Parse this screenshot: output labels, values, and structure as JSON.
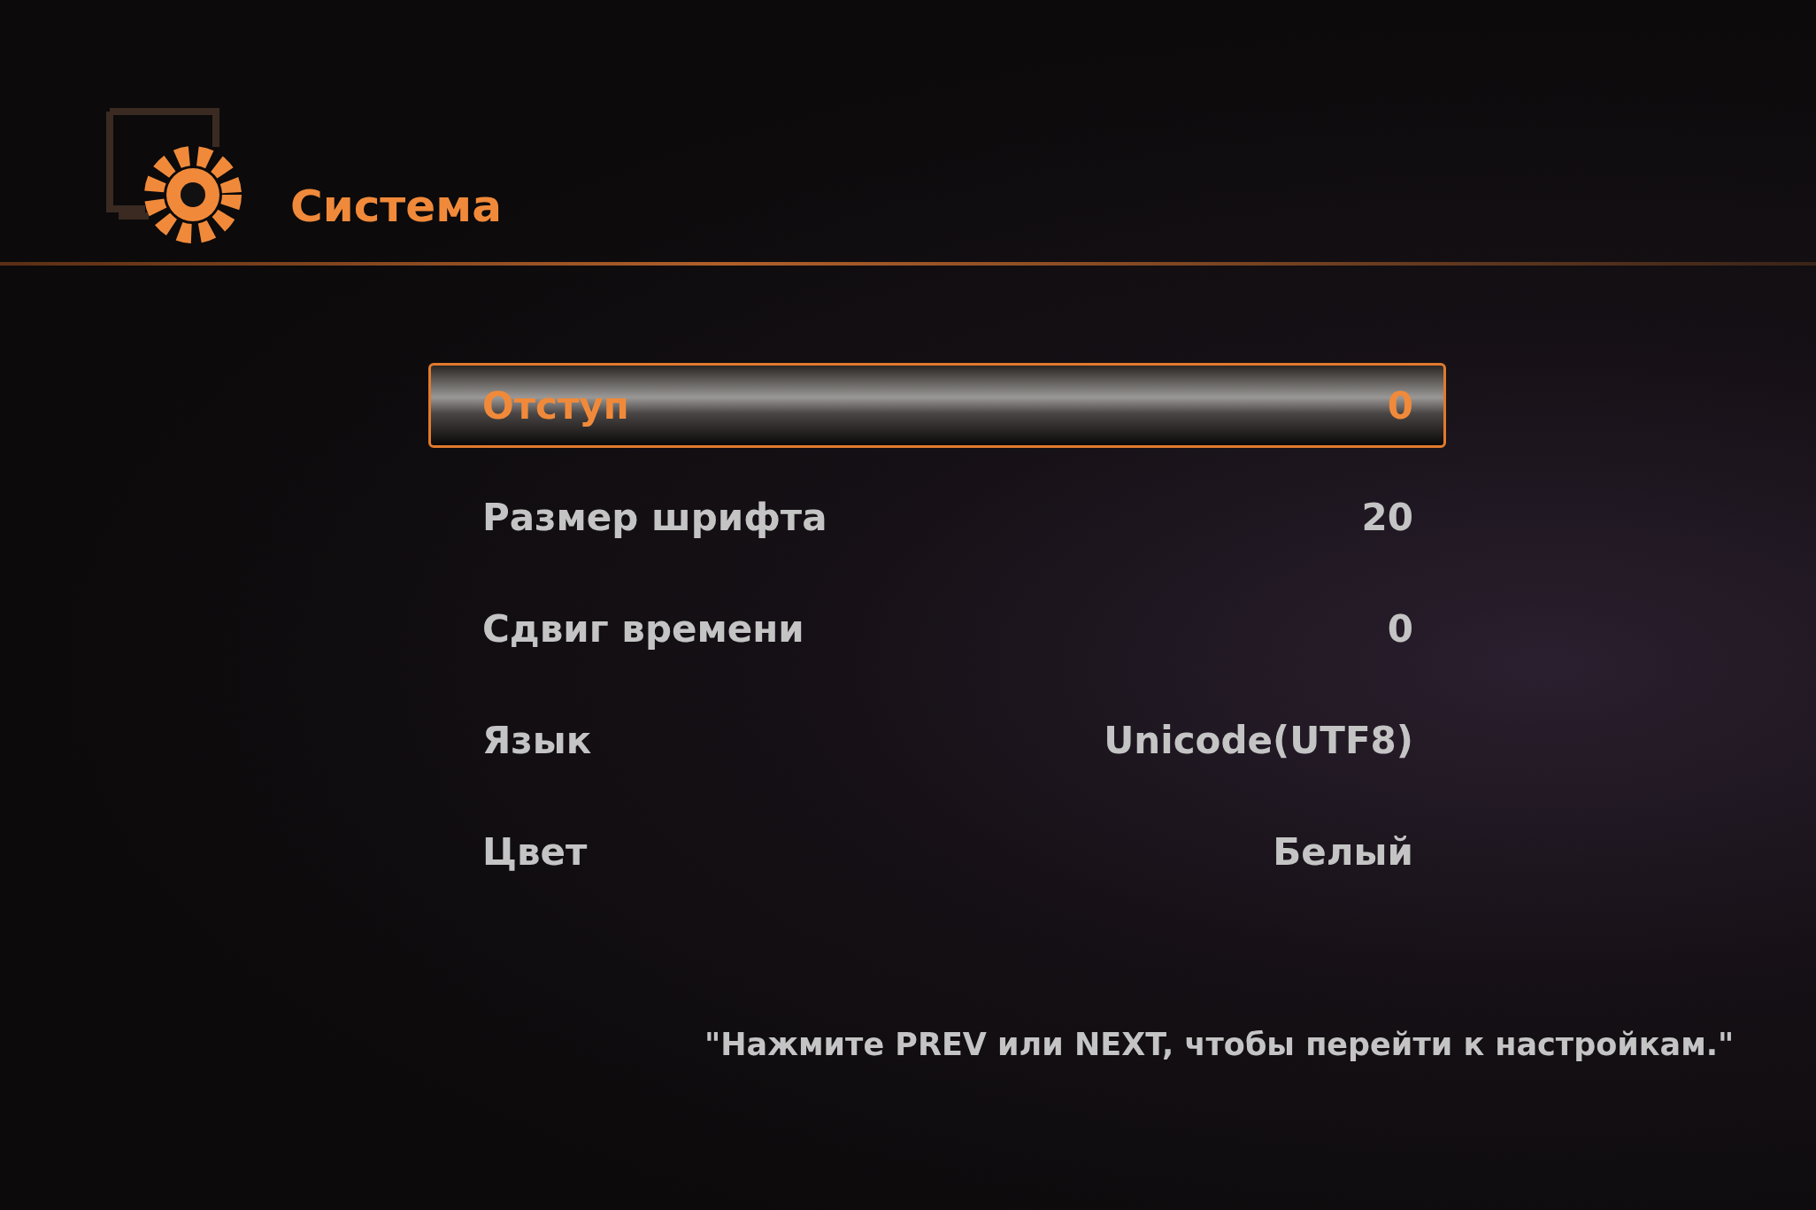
{
  "header": {
    "title": "Система"
  },
  "settings": [
    {
      "label": "Отступ",
      "value": "0",
      "selected": true
    },
    {
      "label": "Размер шрифта",
      "value": "20",
      "selected": false
    },
    {
      "label": "Сдвиг времени",
      "value": "0",
      "selected": false
    },
    {
      "label": "Язык",
      "value": "Unicode(UTF8)",
      "selected": false
    },
    {
      "label": "Цвет",
      "value": "Белый",
      "selected": false
    }
  ],
  "hint": "\"Нажмите PREV или NEXT, чтобы перейти к настройкам.\""
}
